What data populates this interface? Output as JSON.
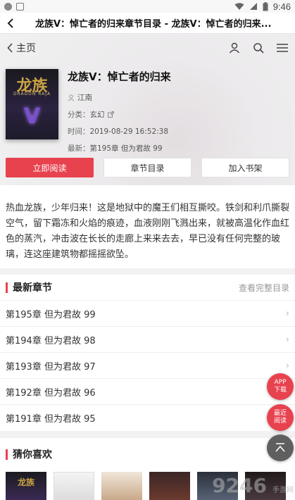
{
  "statusbar": {
    "time": "9:46"
  },
  "titlebar": {
    "title": "龙族V：悼亡者的归来章节目录 - 龙族V：悼亡者的归来..."
  },
  "nav": {
    "home_label": "主页"
  },
  "book": {
    "title": "龙族V：悼亡者的归来",
    "author": "江南",
    "category_label": "分类：",
    "category": "玄幻",
    "time_label": "时间：",
    "time": "2019-08-29 16:52:38",
    "latest_label": "最新：",
    "latest": "第195章 但为君故 99",
    "cover_text_main": "龙族",
    "cover_text_sub": "DRAGON RAJA",
    "cover_text_v": "V"
  },
  "actions": {
    "read": "立即阅读",
    "toc": "章节目录",
    "shelf": "加入书架"
  },
  "intro": "热血龙族，少年归来！这是地狱中的魔王们相互撕咬。铁剑和利爪撕裂空气，留下霜冻和火焰的痕迹，血液刚刚飞溅出来，就被高温化作血红色的蒸汽，冲击波在长长的走廊上来来去去，早已没有任何完整的玻璃，连这座建筑物都摇摇欲坠。",
  "latest_section": {
    "title": "最新章节",
    "more": "查看完整目录",
    "chapters": [
      "第195章 但为君故 99",
      "第194章 但为君故 98",
      "第193章 但为君故 97",
      "第192章 但为君故 96",
      "第191章 但为君故 95"
    ]
  },
  "guess_section": {
    "title": "猜你喜欢"
  },
  "fabs": {
    "app": "APP",
    "download": "下载",
    "recent": "最近",
    "reading": "阅读"
  },
  "watermark": {
    "big": "9246",
    "small": "手游网"
  },
  "colors": {
    "accent": "#e8424f"
  }
}
